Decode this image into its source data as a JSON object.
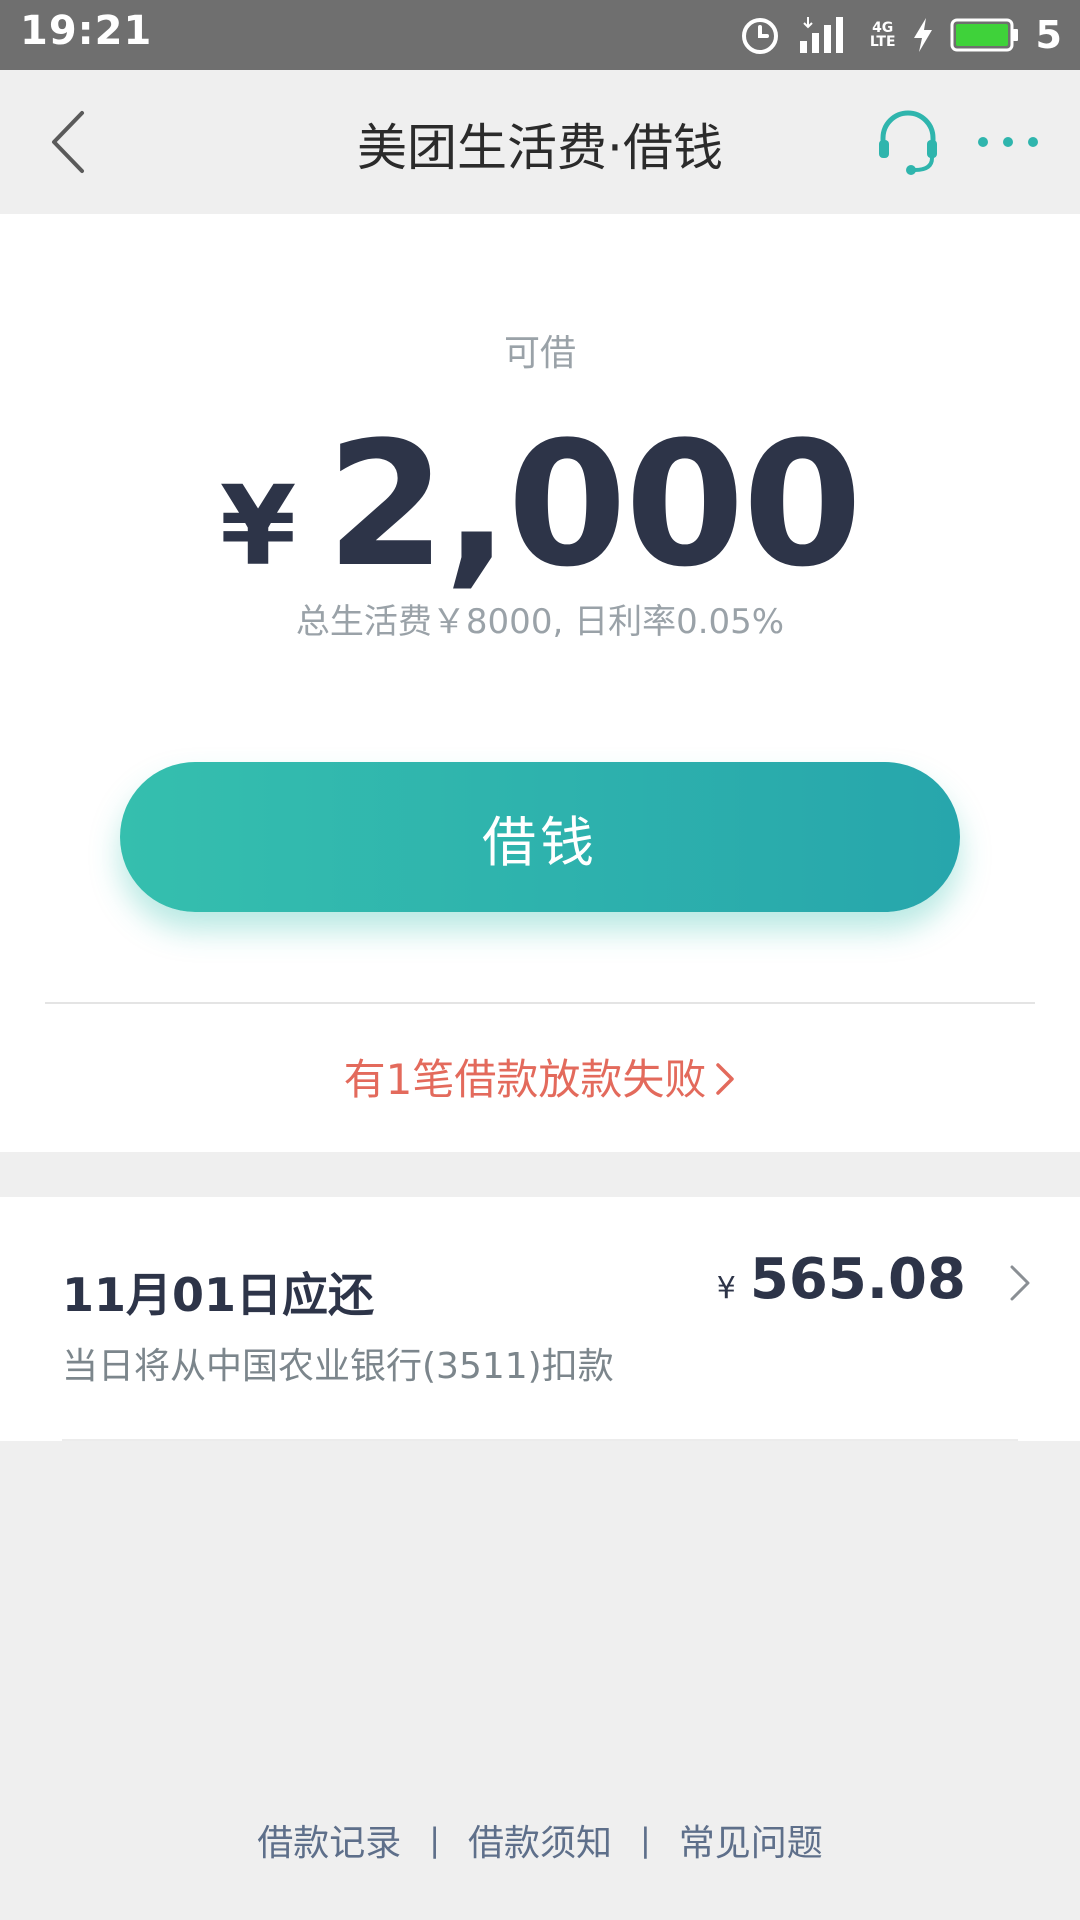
{
  "status_bar": {
    "time": "19:21",
    "network_label": "4G",
    "network_sub": "LTE",
    "battery_level": "5",
    "icons": [
      "alarm-icon",
      "signal-icon",
      "charging-icon",
      "battery-icon"
    ]
  },
  "nav": {
    "title": "美团生活费·借钱",
    "icons": [
      "back-icon",
      "headset-icon",
      "more-icon"
    ]
  },
  "loan": {
    "available_label": "可借",
    "currency": "¥",
    "amount": "2,000",
    "limit_info": "总生活费￥8000, 日利率0.05%",
    "borrow_button": "借钱",
    "fail_notice": "有1笔借款放款失败"
  },
  "repayment": {
    "date_label": "11月01日应还",
    "description": "当日将从中国农业银行(3511)扣款",
    "currency": "¥",
    "amount": "565.08"
  },
  "footer": {
    "links": [
      "借款记录",
      "借款须知",
      "常见问题"
    ],
    "separator": "|"
  },
  "colors": {
    "accent": "#2fb5ad",
    "warning": "#e36a5c",
    "primary_text": "#2d3448",
    "secondary_text": "#9aa2a8",
    "link": "#5e6f8a",
    "battery": "#3fd23a"
  }
}
